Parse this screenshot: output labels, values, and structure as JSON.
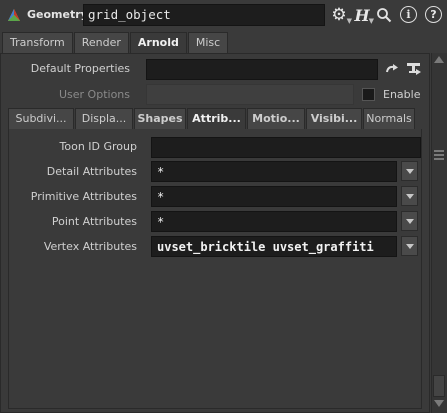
{
  "header": {
    "node_type": "Geometry",
    "node_name": "grid_object",
    "help_glyph": "?",
    "info_glyph": "i",
    "h_glyph": "H"
  },
  "tabs": [
    {
      "label": "Transform",
      "active": false
    },
    {
      "label": "Render",
      "active": false
    },
    {
      "label": "Arnold",
      "active": true
    },
    {
      "label": "Misc",
      "active": false
    }
  ],
  "panel": {
    "default_properties_label": "Default Properties",
    "default_properties_value": "",
    "user_options_label": "User Options",
    "user_options_value": "",
    "enable_label": "Enable"
  },
  "subtabs": [
    {
      "label": "Subdivi..."
    },
    {
      "label": "Displa..."
    },
    {
      "label": "Shapes"
    },
    {
      "label": "Attrib...",
      "active": true
    },
    {
      "label": "Motio..."
    },
    {
      "label": "Visibi..."
    },
    {
      "label": "Normals"
    }
  ],
  "attributes": {
    "toon_id_group": {
      "label": "Toon ID Group",
      "value": ""
    },
    "detail": {
      "label": "Detail Attributes",
      "value": "*"
    },
    "primitive": {
      "label": "Primitive Attributes",
      "value": "*"
    },
    "point": {
      "label": "Point Attributes",
      "value": "*"
    },
    "vertex": {
      "label": "Vertex Attributes",
      "value": "uvset_bricktile uvset_graffiti"
    }
  },
  "colors": {
    "background": "#3a3a3a",
    "field": "#1d1d1d",
    "tab": "#464646"
  }
}
